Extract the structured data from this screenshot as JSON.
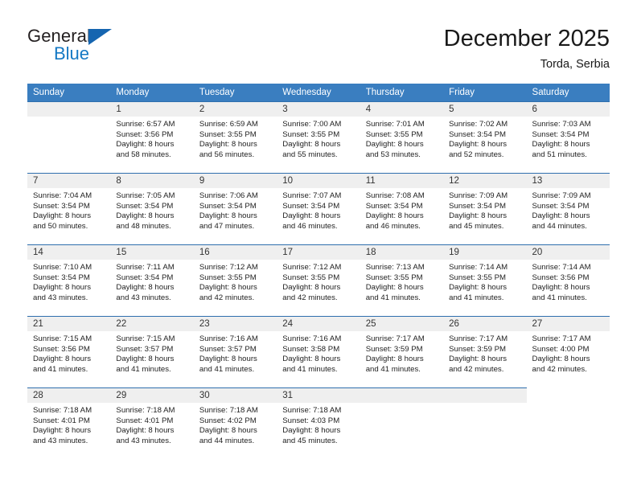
{
  "brand": {
    "name_top": "General",
    "name_bottom": "Blue",
    "triangle_color": "#1565b0",
    "blue_color": "#1579c4"
  },
  "header": {
    "title": "December 2025",
    "subtitle": "Torda, Serbia"
  },
  "theme": {
    "header_bar": "#3a7ec0",
    "row_divider": "#2f6fae",
    "daynum_band": "#efefef"
  },
  "weekdays": [
    "Sunday",
    "Monday",
    "Tuesday",
    "Wednesday",
    "Thursday",
    "Friday",
    "Saturday"
  ],
  "weeks": [
    [
      {
        "day": "",
        "empty": true,
        "lines": []
      },
      {
        "day": "1",
        "lines": [
          "Sunrise: 6:57 AM",
          "Sunset: 3:56 PM",
          "Daylight: 8 hours",
          "and 58 minutes."
        ]
      },
      {
        "day": "2",
        "lines": [
          "Sunrise: 6:59 AM",
          "Sunset: 3:55 PM",
          "Daylight: 8 hours",
          "and 56 minutes."
        ]
      },
      {
        "day": "3",
        "lines": [
          "Sunrise: 7:00 AM",
          "Sunset: 3:55 PM",
          "Daylight: 8 hours",
          "and 55 minutes."
        ]
      },
      {
        "day": "4",
        "lines": [
          "Sunrise: 7:01 AM",
          "Sunset: 3:55 PM",
          "Daylight: 8 hours",
          "and 53 minutes."
        ]
      },
      {
        "day": "5",
        "lines": [
          "Sunrise: 7:02 AM",
          "Sunset: 3:54 PM",
          "Daylight: 8 hours",
          "and 52 minutes."
        ]
      },
      {
        "day": "6",
        "lines": [
          "Sunrise: 7:03 AM",
          "Sunset: 3:54 PM",
          "Daylight: 8 hours",
          "and 51 minutes."
        ]
      }
    ],
    [
      {
        "day": "7",
        "lines": [
          "Sunrise: 7:04 AM",
          "Sunset: 3:54 PM",
          "Daylight: 8 hours",
          "and 50 minutes."
        ]
      },
      {
        "day": "8",
        "lines": [
          "Sunrise: 7:05 AM",
          "Sunset: 3:54 PM",
          "Daylight: 8 hours",
          "and 48 minutes."
        ]
      },
      {
        "day": "9",
        "lines": [
          "Sunrise: 7:06 AM",
          "Sunset: 3:54 PM",
          "Daylight: 8 hours",
          "and 47 minutes."
        ]
      },
      {
        "day": "10",
        "lines": [
          "Sunrise: 7:07 AM",
          "Sunset: 3:54 PM",
          "Daylight: 8 hours",
          "and 46 minutes."
        ]
      },
      {
        "day": "11",
        "lines": [
          "Sunrise: 7:08 AM",
          "Sunset: 3:54 PM",
          "Daylight: 8 hours",
          "and 46 minutes."
        ]
      },
      {
        "day": "12",
        "lines": [
          "Sunrise: 7:09 AM",
          "Sunset: 3:54 PM",
          "Daylight: 8 hours",
          "and 45 minutes."
        ]
      },
      {
        "day": "13",
        "lines": [
          "Sunrise: 7:09 AM",
          "Sunset: 3:54 PM",
          "Daylight: 8 hours",
          "and 44 minutes."
        ]
      }
    ],
    [
      {
        "day": "14",
        "lines": [
          "Sunrise: 7:10 AM",
          "Sunset: 3:54 PM",
          "Daylight: 8 hours",
          "and 43 minutes."
        ]
      },
      {
        "day": "15",
        "lines": [
          "Sunrise: 7:11 AM",
          "Sunset: 3:54 PM",
          "Daylight: 8 hours",
          "and 43 minutes."
        ]
      },
      {
        "day": "16",
        "lines": [
          "Sunrise: 7:12 AM",
          "Sunset: 3:55 PM",
          "Daylight: 8 hours",
          "and 42 minutes."
        ]
      },
      {
        "day": "17",
        "lines": [
          "Sunrise: 7:12 AM",
          "Sunset: 3:55 PM",
          "Daylight: 8 hours",
          "and 42 minutes."
        ]
      },
      {
        "day": "18",
        "lines": [
          "Sunrise: 7:13 AM",
          "Sunset: 3:55 PM",
          "Daylight: 8 hours",
          "and 41 minutes."
        ]
      },
      {
        "day": "19",
        "lines": [
          "Sunrise: 7:14 AM",
          "Sunset: 3:55 PM",
          "Daylight: 8 hours",
          "and 41 minutes."
        ]
      },
      {
        "day": "20",
        "lines": [
          "Sunrise: 7:14 AM",
          "Sunset: 3:56 PM",
          "Daylight: 8 hours",
          "and 41 minutes."
        ]
      }
    ],
    [
      {
        "day": "21",
        "lines": [
          "Sunrise: 7:15 AM",
          "Sunset: 3:56 PM",
          "Daylight: 8 hours",
          "and 41 minutes."
        ]
      },
      {
        "day": "22",
        "lines": [
          "Sunrise: 7:15 AM",
          "Sunset: 3:57 PM",
          "Daylight: 8 hours",
          "and 41 minutes."
        ]
      },
      {
        "day": "23",
        "lines": [
          "Sunrise: 7:16 AM",
          "Sunset: 3:57 PM",
          "Daylight: 8 hours",
          "and 41 minutes."
        ]
      },
      {
        "day": "24",
        "lines": [
          "Sunrise: 7:16 AM",
          "Sunset: 3:58 PM",
          "Daylight: 8 hours",
          "and 41 minutes."
        ]
      },
      {
        "day": "25",
        "lines": [
          "Sunrise: 7:17 AM",
          "Sunset: 3:59 PM",
          "Daylight: 8 hours",
          "and 41 minutes."
        ]
      },
      {
        "day": "26",
        "lines": [
          "Sunrise: 7:17 AM",
          "Sunset: 3:59 PM",
          "Daylight: 8 hours",
          "and 42 minutes."
        ]
      },
      {
        "day": "27",
        "lines": [
          "Sunrise: 7:17 AM",
          "Sunset: 4:00 PM",
          "Daylight: 8 hours",
          "and 42 minutes."
        ]
      }
    ],
    [
      {
        "day": "28",
        "lines": [
          "Sunrise: 7:18 AM",
          "Sunset: 4:01 PM",
          "Daylight: 8 hours",
          "and 43 minutes."
        ]
      },
      {
        "day": "29",
        "lines": [
          "Sunrise: 7:18 AM",
          "Sunset: 4:01 PM",
          "Daylight: 8 hours",
          "and 43 minutes."
        ]
      },
      {
        "day": "30",
        "lines": [
          "Sunrise: 7:18 AM",
          "Sunset: 4:02 PM",
          "Daylight: 8 hours",
          "and 44 minutes."
        ]
      },
      {
        "day": "31",
        "lines": [
          "Sunrise: 7:18 AM",
          "Sunset: 4:03 PM",
          "Daylight: 8 hours",
          "and 45 minutes."
        ]
      },
      {
        "day": "",
        "empty": true,
        "lines": []
      },
      {
        "day": "",
        "empty": true,
        "lines": []
      },
      {
        "day": "",
        "empty": true,
        "trailing": true,
        "lines": []
      }
    ]
  ]
}
